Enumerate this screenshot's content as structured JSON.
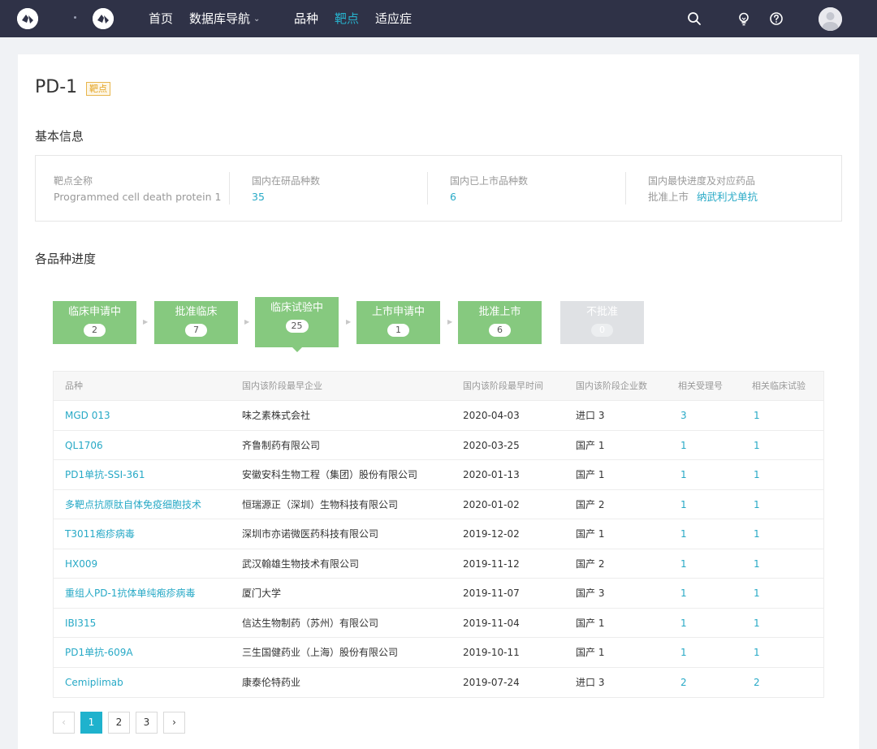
{
  "nav": {
    "items": [
      {
        "label": "首页",
        "active": false
      },
      {
        "label": "数据库导航",
        "active": false,
        "dropdown": true
      },
      {
        "label": "品种",
        "active": false
      },
      {
        "label": "靶点",
        "active": true
      },
      {
        "label": "适应症",
        "active": false
      }
    ],
    "icons": [
      "search-icon",
      "lightbulb-icon",
      "help-icon",
      "avatar"
    ]
  },
  "page": {
    "title": "PD-1",
    "tag": "靶点"
  },
  "basic_info": {
    "section_title": "基本信息",
    "target_full_name": {
      "label": "靶点全称",
      "value": "Programmed cell death protein 1"
    },
    "domestic_in_research": {
      "label": "国内在研品种数",
      "value": "35"
    },
    "domestic_marketed": {
      "label": "国内已上市品种数",
      "value": "6"
    },
    "fastest_progress": {
      "label": "国内最快进度及对应药品",
      "stage": "批准上市",
      "drug": "纳武利尤单抗"
    }
  },
  "progress": {
    "section_title": "各品种进度",
    "stages": [
      {
        "label": "临床申请中",
        "count": "2",
        "state": "normal"
      },
      {
        "label": "批准临床",
        "count": "7",
        "state": "normal"
      },
      {
        "label": "临床试验中",
        "count": "25",
        "state": "active"
      },
      {
        "label": "上市申请中",
        "count": "1",
        "state": "normal"
      },
      {
        "label": "批准上市",
        "count": "6",
        "state": "normal"
      },
      {
        "label": "不批准",
        "count": "0",
        "state": "disabled"
      }
    ]
  },
  "table": {
    "headers": [
      "品种",
      "国内该阶段最早企业",
      "国内该阶段最早时间",
      "国内该阶段企业数",
      "相关受理号",
      "相关临床试验"
    ],
    "rows": [
      [
        "MGD 013",
        "味之素株式会社",
        "2020-04-03",
        "进口 3",
        "3",
        "1"
      ],
      [
        "QL1706",
        "齐鲁制药有限公司",
        "2020-03-25",
        "国产 1",
        "1",
        "1"
      ],
      [
        "PD1单抗-SSI-361",
        "安徽安科生物工程（集团）股份有限公司",
        "2020-01-13",
        "国产 1",
        "1",
        "1"
      ],
      [
        "多靶点抗原肽自体免疫细胞技术",
        "恒瑞源正（深圳）生物科技有限公司",
        "2020-01-02",
        "国产 2",
        "1",
        "1"
      ],
      [
        "T3011疱疹病毒",
        "深圳市亦诺微医药科技有限公司",
        "2019-12-02",
        "国产 1",
        "1",
        "1"
      ],
      [
        "HX009",
        "武汉翰雄生物技术有限公司",
        "2019-11-12",
        "国产 2",
        "1",
        "1"
      ],
      [
        "重组人PD-1抗体单纯疱疹病毒",
        "厦门大学",
        "2019-11-07",
        "国产 3",
        "1",
        "1"
      ],
      [
        "IBI315",
        "信达生物制药（苏州）有限公司",
        "2019-11-04",
        "国产 1",
        "1",
        "1"
      ],
      [
        "PD1单抗-609A",
        "三生国健药业（上海）股份有限公司",
        "2019-10-11",
        "国产 1",
        "1",
        "1"
      ],
      [
        "Cemiplimab",
        "康泰伦特药业",
        "2019-07-24",
        "进口 3",
        "2",
        "2"
      ]
    ]
  },
  "pagination": {
    "prev": "‹",
    "pages": [
      "1",
      "2",
      "3"
    ],
    "current": "1",
    "next": "›"
  },
  "colors": {
    "nav_bg": "#2f3247",
    "accent": "#27a9c6",
    "stage_green": "#86c97f",
    "stage_disabled": "#dfe1e4",
    "tag_orange": "#e4a423"
  }
}
